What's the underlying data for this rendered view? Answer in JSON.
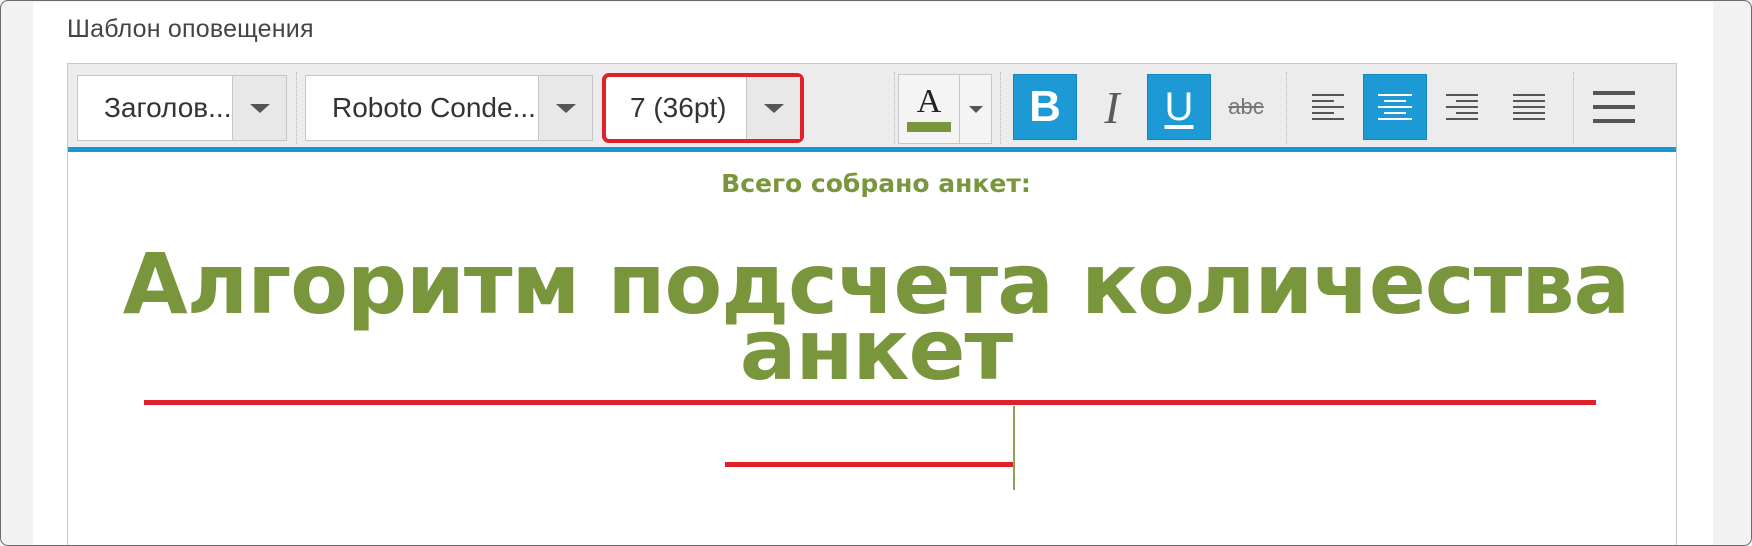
{
  "section": {
    "label": "Шаблон оповещения"
  },
  "toolbar": {
    "format_select": {
      "value": "Заголов..."
    },
    "font_select": {
      "value": "Roboto Conde..."
    },
    "size_select": {
      "value": "7 (36pt)"
    },
    "text_color_button": {
      "letter": "A",
      "color": "#7a963c"
    },
    "bold_button": {
      "glyph": "B",
      "active": true
    },
    "italic_button": {
      "glyph": "I",
      "active": false
    },
    "underline_button": {
      "glyph": "U",
      "active": true
    },
    "strikethrough_button": {
      "glyph": "abc",
      "active": false
    },
    "align": {
      "active": "center",
      "options": [
        "left",
        "center",
        "right",
        "justify"
      ]
    },
    "menu_icon": "hamburger-icon"
  },
  "content": {
    "subtitle": "Всего собрано анкет:",
    "headline_line1": "Алгоритм подсчета количества",
    "headline_line2": "анкет"
  },
  "colors": {
    "accent": "#1a96d3",
    "text_green": "#7a963c",
    "highlight_red": "#e0202a"
  }
}
